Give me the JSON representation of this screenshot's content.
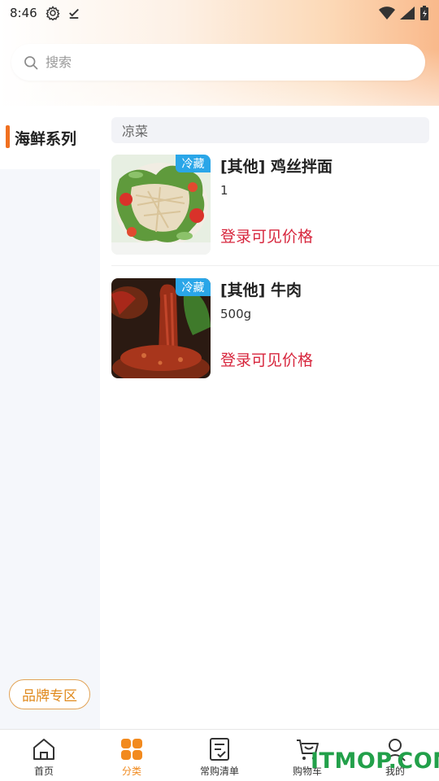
{
  "status_bar": {
    "time": "8:46"
  },
  "search": {
    "placeholder": "搜索"
  },
  "sidebar": {
    "items": [
      {
        "label": "海鲜系列",
        "active": true
      }
    ],
    "brand_button": "品牌专区"
  },
  "main": {
    "category": "凉菜",
    "products": [
      {
        "name": "[其他] 鸡丝拌面",
        "spec": "1",
        "price_text": "登录可见价格",
        "tag": "冷藏"
      },
      {
        "name": "[其他] 牛肉",
        "spec": "500g",
        "price_text": "登录可见价格",
        "tag": "冷藏"
      }
    ]
  },
  "bottom_nav": {
    "items": [
      {
        "label": "首页",
        "icon": "home-icon"
      },
      {
        "label": "分类",
        "icon": "category-icon",
        "active": true
      },
      {
        "label": "常购清单",
        "icon": "list-icon"
      },
      {
        "label": "购物车",
        "icon": "cart-icon"
      },
      {
        "label": "我的",
        "icon": "user-icon"
      }
    ]
  },
  "watermark": "ITMOP.COM",
  "colors": {
    "accent": "#f07020",
    "price": "#d7263d",
    "tag": "#2aa6e8",
    "brand_border": "#e2a356"
  }
}
